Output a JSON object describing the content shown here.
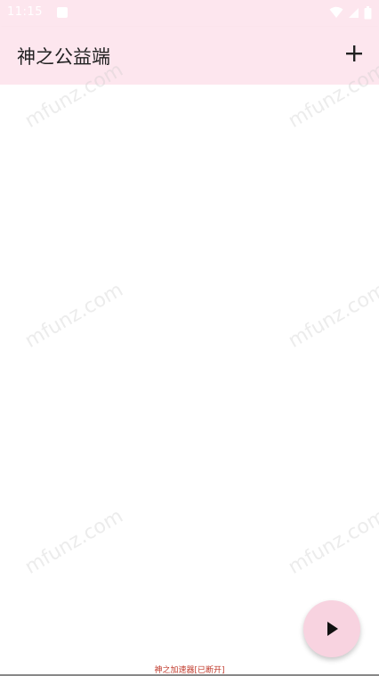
{
  "status_bar": {
    "time": "11:15",
    "background": "#fde6ee",
    "icons": [
      "notification-icon",
      "wifi-icon",
      "signal-icon",
      "battery-icon"
    ]
  },
  "app_bar": {
    "title": "神之公益端",
    "add_icon": "plus-icon",
    "background": "#fde6ee"
  },
  "watermark": {
    "text": "mfunz.com"
  },
  "fab": {
    "icon": "play-icon",
    "background": "#f8d3e0"
  },
  "footer": {
    "status_text": "神之加速器[已断开]",
    "color": "#c0392b"
  }
}
